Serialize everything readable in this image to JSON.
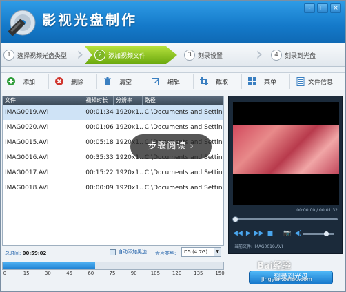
{
  "app": {
    "title": "影视光盘制作",
    "win_buttons": [
      "-",
      "□",
      "×"
    ]
  },
  "steps": [
    {
      "num": "1",
      "label": "选择视频光盘类型"
    },
    {
      "num": "2",
      "label": "添加视频文件"
    },
    {
      "num": "3",
      "label": "刻录设置"
    },
    {
      "num": "4",
      "label": "刻录到光盘"
    }
  ],
  "toolbar": {
    "add": "添加",
    "delete": "删除",
    "clear": "清空",
    "edit": "编辑",
    "crop": "截取",
    "menu": "菜单",
    "fileinfo": "文件信息"
  },
  "table": {
    "headers": [
      "文件",
      "视频时长",
      "分辨率",
      "路径"
    ],
    "rows": [
      [
        "IMAG0019.AVI",
        "00:01:34",
        "1920x1...",
        "C:\\Documents and Settin..."
      ],
      [
        "IMAG0020.AVI",
        "00:01:06",
        "1920x1...",
        "C:\\Documents and Settin..."
      ],
      [
        "IMAG0015.AVI",
        "00:05:18",
        "1920x1...",
        "C:\\Documents and Settin..."
      ],
      [
        "IMAG0016.AVI",
        "00:35:33",
        "1920x1...",
        "C:\\Documents and Settin..."
      ],
      [
        "IMAG0017.AVI",
        "00:15:22",
        "1920x1...",
        "C:\\Documents and Settin..."
      ],
      [
        "IMAG0018.AVI",
        "00:00:09",
        "1920x1...",
        "C:\\Documents and Settin..."
      ]
    ]
  },
  "footer": {
    "total_label": "总时间:",
    "total_value": "00:59:02",
    "auto_border": "自动添加黑边",
    "disc_type_label": "盘片类型:",
    "disc_type_value": "D5 (4.7G)",
    "capacity_fraction": 0.42,
    "scale": [
      "0",
      "15",
      "30",
      "45",
      "60",
      "75",
      "90",
      "105",
      "120",
      "135",
      "150"
    ]
  },
  "preview": {
    "timecode": "00:00:00 / 00:01:32",
    "current_file": "当前文件: IMAG0019.AVI",
    "seek_fraction": 0.0
  },
  "burn_button": "刻录到光盘",
  "overlay": {
    "text": "步骤阅读 ›"
  },
  "watermark": {
    "line1": "Bai经验",
    "line2": "jingyan.baidu.com"
  },
  "colors": {
    "accent": "#1479c9",
    "active_step": "#7db624"
  }
}
